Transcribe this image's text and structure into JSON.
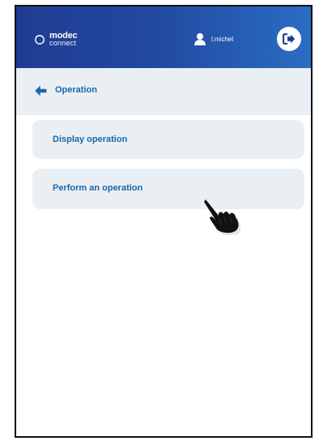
{
  "header": {
    "logo_brand": "modec",
    "logo_sub": "connect",
    "username": "l.michel"
  },
  "breadcrumb": {
    "title": "Operation"
  },
  "menu": {
    "items": [
      {
        "label": "Display operation"
      },
      {
        "label": "Perform an operation"
      }
    ]
  },
  "icons": {
    "logo": "modec-logo-icon",
    "user": "user-icon",
    "logout": "logout-icon",
    "back": "arrow-left-icon",
    "cursor": "hand-pointer-icon"
  },
  "colors": {
    "header_gradient_start": "#1f3c92",
    "header_gradient_end": "#2a6dc3",
    "accent_text": "#1967a8",
    "panel_background": "#eaeff4"
  }
}
